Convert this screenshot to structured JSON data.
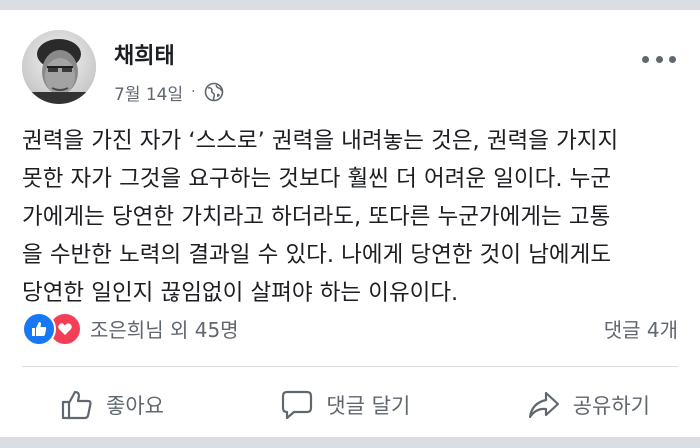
{
  "post": {
    "author": "채희태",
    "date": "7월 14일",
    "separator": "·",
    "privacy_icon": "globe-icon",
    "more_icon": "more-horizontal-icon",
    "text_lines": [
      "권력을 가진 자가 ‘스스로’ 권력을 내려놓는 것은, 권력을 가지지",
      "못한 자가 그것을 요구하는 것보다 훨씬 더 어려운 일이다. 누군",
      "가에게는 당연한 가치라고 하더라도, 또다른 누군가에게는 고통",
      "을 수반한 노력의 결과일 수 있다. 나에게 당연한 것이 남에게도",
      "당연한 일인지 끊임없이 살펴야 하는 이유이다."
    ]
  },
  "reactions": {
    "types": [
      "like",
      "love"
    ],
    "summary": "조은희님 외 45명",
    "comments": "댓글 4개",
    "like_color": "#1877f2",
    "love_color": "#f33e58"
  },
  "actions": {
    "like_label": "좋아요",
    "comment_label": "댓글 달기",
    "share_label": "공유하기",
    "like_icon": "thumbs-up-icon",
    "comment_icon": "comment-bubble-icon",
    "share_icon": "share-arrow-icon"
  }
}
